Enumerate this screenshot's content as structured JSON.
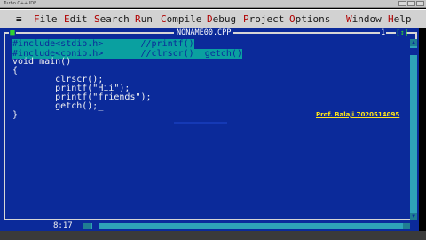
{
  "window": {
    "title": "Turbo C++ IDE"
  },
  "menubar": {
    "system_icon": "≡",
    "items": [
      {
        "hot": "F",
        "rest": "ile"
      },
      {
        "hot": "E",
        "rest": "dit"
      },
      {
        "hot": "S",
        "rest": "earch"
      },
      {
        "hot": "R",
        "rest": "un"
      },
      {
        "hot": "C",
        "rest": "ompile"
      },
      {
        "hot": "D",
        "rest": "ebug"
      },
      {
        "hot": "P",
        "rest": "roject"
      },
      {
        "hot": "O",
        "rest": "ptions"
      },
      {
        "hot": "W",
        "rest": "indow"
      },
      {
        "hot": "H",
        "rest": "elp"
      }
    ]
  },
  "editor": {
    "filename": "NONAME00.CPP",
    "close_glyph": "■",
    "window_number": "1",
    "zoom_glyph": "[↕]",
    "lines": [
      {
        "text": "#include<stdio.h>       //printf()",
        "highlight": true
      },
      {
        "text": "#include<conio.h>       //clrscr()  getch()",
        "highlight": true
      },
      {
        "text": "void main()",
        "highlight": false
      },
      {
        "text": "{",
        "highlight": false
      },
      {
        "text": "        clrscr();",
        "highlight": false
      },
      {
        "text": "        printf(\"Hii\");",
        "highlight": false
      },
      {
        "text": "        printf(\"friends\");",
        "highlight": false
      },
      {
        "text": "        getch();_",
        "highlight": false
      },
      {
        "text": "}",
        "highlight": false
      }
    ]
  },
  "overlay": {
    "credit": "Prof. Balaji 7020514095"
  },
  "status": {
    "position": "8:17"
  },
  "colors": {
    "editor_bg": "#0b2a9a",
    "highlight": "#0aa0a0",
    "menubar_bg": "#d2d2d2",
    "credit": "#ffe41a"
  }
}
